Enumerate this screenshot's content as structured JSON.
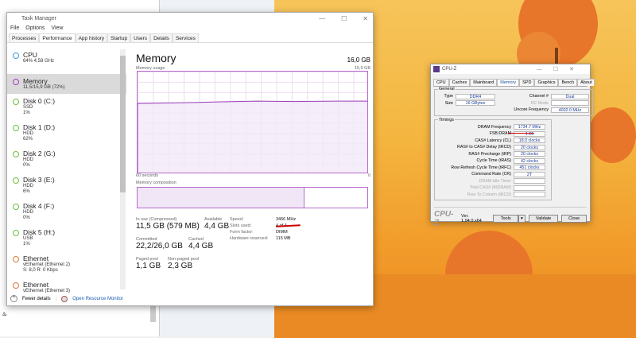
{
  "taskmanager": {
    "title": "Task Manager",
    "menu": [
      "File",
      "Options",
      "View"
    ],
    "tabs": [
      "Processes",
      "Performance",
      "App history",
      "Startup",
      "Users",
      "Details",
      "Services"
    ],
    "active_tab": "Performance",
    "sidebar": [
      {
        "name": "CPU",
        "sub1": "64% 4,58 GHz",
        "sub2": "",
        "color": "#3f9ae0"
      },
      {
        "name": "Memory",
        "sub1": "11,5/15,9 GB (72%)",
        "sub2": "",
        "color": "#a43ac6",
        "selected": true
      },
      {
        "name": "Disk 0 (C:)",
        "sub1": "SSD",
        "sub2": "1%",
        "color": "#6cbf3a"
      },
      {
        "name": "Disk 1 (D:)",
        "sub1": "HDD",
        "sub2": "62%",
        "color": "#6cbf3a"
      },
      {
        "name": "Disk 2 (G:)",
        "sub1": "HDD",
        "sub2": "0%",
        "color": "#6cbf3a"
      },
      {
        "name": "Disk 3 (E:)",
        "sub1": "HDD",
        "sub2": "6%",
        "color": "#6cbf3a"
      },
      {
        "name": "Disk 4 (F:)",
        "sub1": "HDD",
        "sub2": "0%",
        "color": "#6cbf3a"
      },
      {
        "name": "Disk 5 (H:)",
        "sub1": "USB",
        "sub2": "1%",
        "color": "#6cbf3a"
      },
      {
        "name": "Ethernet",
        "sub1": "vEthernet (Ethernet 2)",
        "sub2": "S: 8,0 R: 0 Kbps",
        "color": "#d97a3a"
      },
      {
        "name": "Ethernet",
        "sub1": "vEthernet (Ethernet 3)",
        "sub2": "",
        "color": "#d97a3a"
      }
    ],
    "main": {
      "title": "Memory",
      "total": "16,0 GB",
      "usage_label": "Memory usage",
      "usage_max": "15,9 GB",
      "time_left": "60 seconds",
      "time_right": "0",
      "usage_percent": 72,
      "composition_label": "Memory composition",
      "stats": {
        "in_use_label": "In use (Compressed)",
        "in_use": "11,5 GB (579 MB)",
        "available_label": "Available",
        "available": "4,4 GB",
        "committed_label": "Committed",
        "committed": "22,2/26,0 GB",
        "cached_label": "Cached",
        "cached": "4,4 GB",
        "paged_label": "Paged pool",
        "paged": "1,1 GB",
        "nonpaged_label": "Non-paged pool",
        "nonpaged": "2,3 GB"
      },
      "props": [
        {
          "k": "Speed:",
          "v": "3466 MHz"
        },
        {
          "k": "Slots used:",
          "v": "4 of 4"
        },
        {
          "k": "Form factor:",
          "v": "DIMM"
        },
        {
          "k": "Hardware reserved:",
          "v": "115 MB"
        }
      ]
    },
    "footer": {
      "fewer": "Fewer details",
      "monitor": "Open Resource Monitor"
    }
  },
  "cpuz": {
    "title": "CPU-Z",
    "tabs": [
      "CPU",
      "Caches",
      "Mainboard",
      "Memory",
      "SPD",
      "Graphics",
      "Bench",
      "About"
    ],
    "active_tab": "Memory",
    "general_label": "General",
    "type_label": "Type",
    "type": "DDR4",
    "size_label": "Size",
    "size": "16 GBytes",
    "channel_label": "Channel #",
    "channel": "Dual",
    "dc_label": "DC Mode",
    "uncore_label": "Uncore Frequency",
    "uncore": "4002.0 MHz",
    "timings_label": "Timings",
    "timings": [
      {
        "k": "DRAM Frequency",
        "v": "1734.7 MHz"
      },
      {
        "k": "FSB:DRAM",
        "v": "1:26"
      },
      {
        "k": "CAS# Latency (CL)",
        "v": "18.0 clocks"
      },
      {
        "k": "RAS# to CAS# Delay (tRCD)",
        "v": "20 clocks"
      },
      {
        "k": "RAS# Precharge (tRP)",
        "v": "20 clocks"
      },
      {
        "k": "Cycle Time (tRAS)",
        "v": "42 clocks"
      },
      {
        "k": "Row Refresh Cycle Time (tRFC)",
        "v": "451 clocks"
      },
      {
        "k": "Command Rate (CR)",
        "v": "2T"
      }
    ],
    "disabled": [
      "DRAM Idle Timer",
      "Total CAS# (tRDRAM)",
      "Row To Column (tRCD)"
    ],
    "logo": "CPU-Z",
    "version": "Ver. 1.94.0.x64",
    "tools": "Tools",
    "validate": "Validate",
    "close": "Close"
  },
  "background": {
    "text": "ಹಿ"
  }
}
